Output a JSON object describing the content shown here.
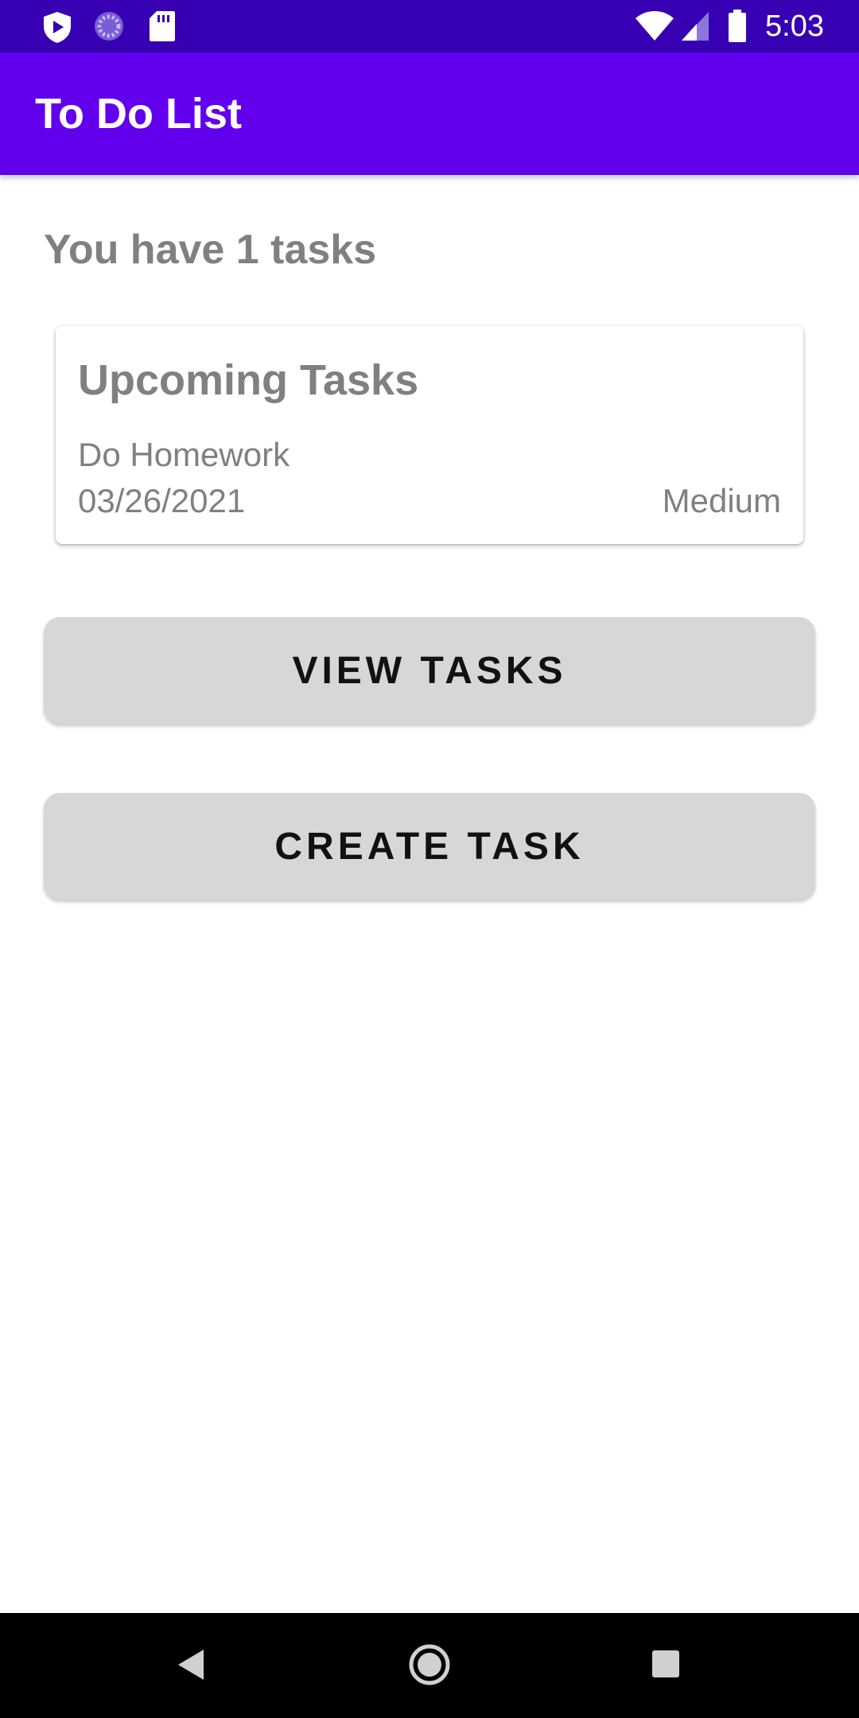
{
  "status_bar": {
    "time": "5:03",
    "left_icons": [
      "shield-play-icon",
      "loading-spinner-icon",
      "sd-card-icon"
    ],
    "right_icons": [
      "wifi-icon",
      "cell-signal-icon",
      "battery-icon"
    ],
    "background_color": "#3700b3"
  },
  "app_bar": {
    "title": "To Do List",
    "background_color": "#6200ee"
  },
  "main": {
    "task_count_text": "You have 1 tasks",
    "upcoming_card": {
      "title": "Upcoming Tasks",
      "task_name": "Do Homework",
      "task_date": "03/26/2021",
      "task_priority": "Medium"
    },
    "view_tasks_label": "VIEW TASKS",
    "create_task_label": "CREATE TASK",
    "button_color": "#d6d7d7"
  },
  "nav_bar": {
    "buttons": [
      "back-icon",
      "home-icon",
      "recents-icon"
    ]
  }
}
